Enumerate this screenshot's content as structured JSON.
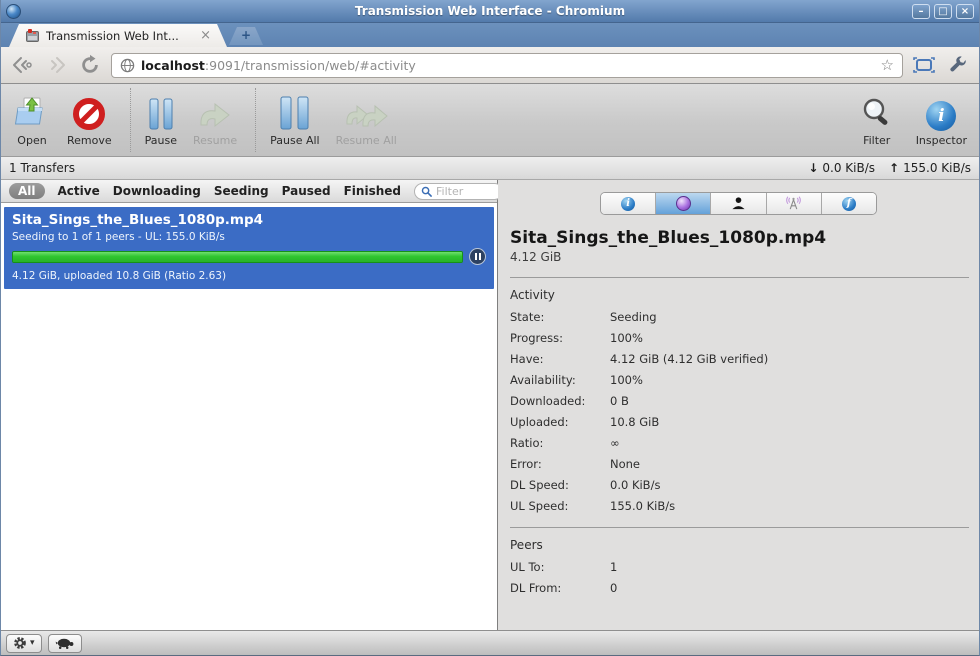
{
  "titlebar": {
    "title": "Transmission Web Interface - Chromium",
    "buttons": {
      "minimize": "–",
      "maximize": "□",
      "close": "×"
    }
  },
  "tabstrip": {
    "tab_title": "Transmission Web Int...",
    "tab_close": "×",
    "new_tab": "+"
  },
  "navbar": {
    "url_host": "localhost",
    "url_rest": ":9091/transmission/web/#activity",
    "star": "☆"
  },
  "toolbar": {
    "open": "Open",
    "remove": "Remove",
    "pause": "Pause",
    "resume": "Resume",
    "pause_all": "Pause All",
    "resume_all": "Resume All",
    "filter": "Filter",
    "inspector": "Inspector"
  },
  "statusbar": {
    "transfers": "1 Transfers",
    "down_arrow": "↓",
    "down_speed": "0.0 KiB/s",
    "up_arrow": "↑",
    "up_speed": "155.0 KiB/s"
  },
  "filterbar": {
    "tabs": [
      "All",
      "Active",
      "Downloading",
      "Seeding",
      "Paused",
      "Finished"
    ],
    "selected": "All",
    "search_placeholder": "Filter"
  },
  "torrent": {
    "name": "Sita_Sings_the_Blues_1080p.mp4",
    "status_line": "Seeding to 1 of 1 peers - UL: 155.0 KiB/s",
    "progress_percent": 100,
    "detail_line": "4.12 GiB, uploaded 10.8 GiB (Ratio 2.63)"
  },
  "inspector": {
    "tabs": [
      {
        "name": "info"
      },
      {
        "name": "activity",
        "selected": true
      },
      {
        "name": "peers"
      },
      {
        "name": "trackers"
      },
      {
        "name": "files"
      }
    ],
    "title": "Sita_Sings_the_Blues_1080p.mp4",
    "size": "4.12 GiB",
    "activity": {
      "heading": "Activity",
      "rows": [
        {
          "label": "State:",
          "value": "Seeding"
        },
        {
          "label": "Progress:",
          "value": "100%"
        },
        {
          "label": "Have:",
          "value": "4.12 GiB (4.12 GiB verified)"
        },
        {
          "label": "Availability:",
          "value": "100%"
        },
        {
          "label": "Downloaded:",
          "value": "0 B"
        },
        {
          "label": "Uploaded:",
          "value": "10.8 GiB"
        },
        {
          "label": "Ratio:",
          "value": "∞"
        },
        {
          "label": "Error:",
          "value": "None"
        },
        {
          "label": "DL Speed:",
          "value": "0.0 KiB/s"
        },
        {
          "label": "UL Speed:",
          "value": "155.0 KiB/s"
        }
      ]
    },
    "peers": {
      "heading": "Peers",
      "rows": [
        {
          "label": "UL To:",
          "value": "1"
        },
        {
          "label": "DL From:",
          "value": "0"
        }
      ]
    }
  },
  "footer": {
    "gear_caret": "▾"
  },
  "colors": {
    "selection_blue": "#3b6cc5",
    "progress_green": "#2fc52f",
    "titlebar_blue": "#527aab",
    "inspector_tab_selected": "#64a1d9"
  }
}
